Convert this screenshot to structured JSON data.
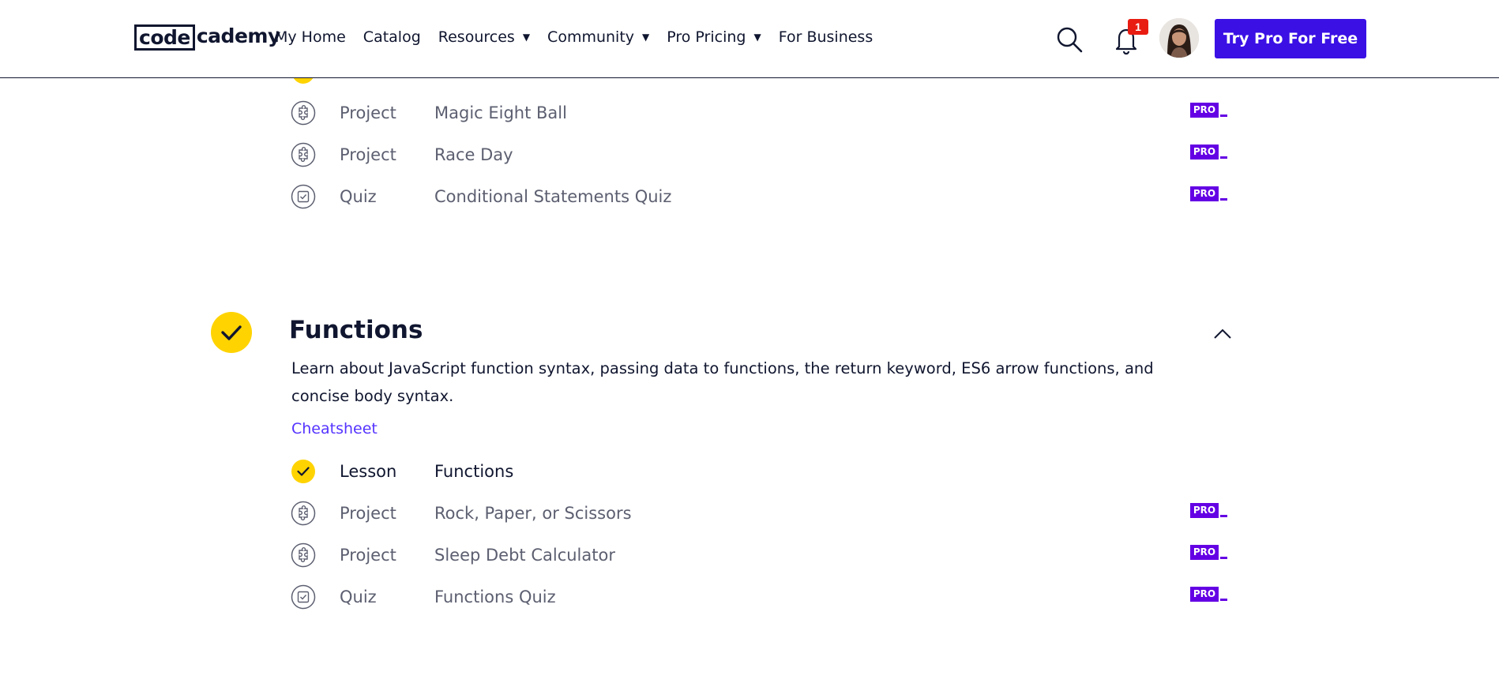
{
  "header": {
    "logo_code": "code",
    "logo_rest": "cademy",
    "nav": [
      {
        "label": "My Home",
        "dropdown": false
      },
      {
        "label": "Catalog",
        "dropdown": false
      },
      {
        "label": "Resources",
        "dropdown": true
      },
      {
        "label": "Community",
        "dropdown": true
      },
      {
        "label": "Pro Pricing",
        "dropdown": true
      },
      {
        "label": "For Business",
        "dropdown": false
      }
    ],
    "caret": "▼",
    "notification_count": "1",
    "cta_label": "Try Pro For Free"
  },
  "previous_module": {
    "items": [
      {
        "type": "Project",
        "title": "Magic Eight Ball",
        "icon": "puzzle-icon",
        "pro": "PRO"
      },
      {
        "type": "Project",
        "title": "Race Day",
        "icon": "puzzle-icon",
        "pro": "PRO"
      },
      {
        "type": "Quiz",
        "title": "Conditional Statements Quiz",
        "icon": "quiz-icon",
        "pro": "PRO"
      }
    ]
  },
  "module": {
    "title": "Functions",
    "description": "Learn about JavaScript function syntax, passing data to functions, the return keyword, ES6 arrow functions, and concise body syntax.",
    "cheatsheet_label": "Cheatsheet",
    "items": [
      {
        "type": "Lesson",
        "title": "Functions",
        "icon": "check-icon",
        "completed": true
      },
      {
        "type": "Project",
        "title": "Rock, Paper, or Scissors",
        "icon": "puzzle-icon",
        "pro": "PRO"
      },
      {
        "type": "Project",
        "title": "Sleep Debt Calculator",
        "icon": "puzzle-icon",
        "pro": "PRO"
      },
      {
        "type": "Quiz",
        "title": "Functions Quiz",
        "icon": "quiz-icon",
        "pro": "PRO"
      }
    ]
  },
  "colors": {
    "accent": "#3a10e5",
    "pro_badge": "#6400e4",
    "check_yellow": "#ffd300",
    "notification": "#e91c11",
    "link": "#5533ff"
  }
}
